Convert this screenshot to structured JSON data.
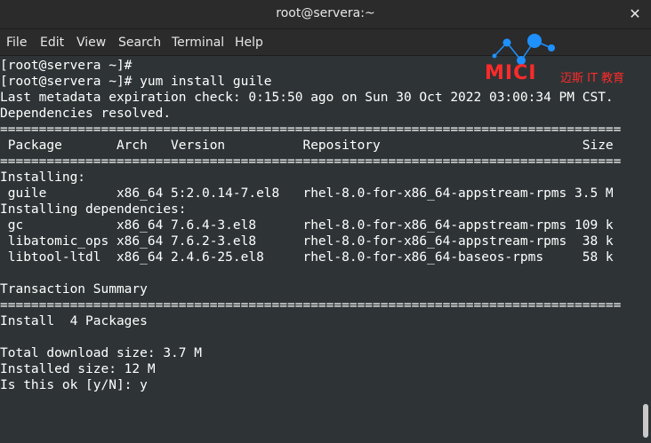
{
  "window": {
    "title": "root@servera:~",
    "close_glyph": "✕"
  },
  "menu": [
    "File",
    "Edit",
    "View",
    "Search",
    "Terminal",
    "Help"
  ],
  "watermark": {
    "brand": "MICI",
    "subtitle": "迈斯 IT 教育",
    "color": "#ff2a2a",
    "dots_color": "#1e90ff"
  },
  "terminal": {
    "lines": [
      "[root@servera ~]#",
      "[root@servera ~]# yum install guile",
      "Last metadata expiration check: 0:15:50 ago on Sun 30 Oct 2022 03:00:34 PM CST.",
      "Dependencies resolved.",
      "================================================================================",
      " Package       Arch   Version          Repository                          Size",
      "================================================================================",
      "Installing:",
      " guile         x86_64 5:2.0.14-7.el8   rhel-8.0-for-x86_64-appstream-rpms 3.5 M",
      "Installing dependencies:",
      " gc            x86_64 7.6.4-3.el8      rhel-8.0-for-x86_64-appstream-rpms 109 k",
      " libatomic_ops x86_64 7.6.2-3.el8      rhel-8.0-for-x86_64-appstream-rpms  38 k",
      " libtool-ltdl  x86_64 2.4.6-25.el8     rhel-8.0-for-x86_64-baseos-rpms     58 k",
      "",
      "Transaction Summary",
      "================================================================================",
      "Install  4 Packages",
      "",
      "Total download size: 3.7 M",
      "Installed size: 12 M",
      "Is this ok [y/N]: y"
    ]
  }
}
